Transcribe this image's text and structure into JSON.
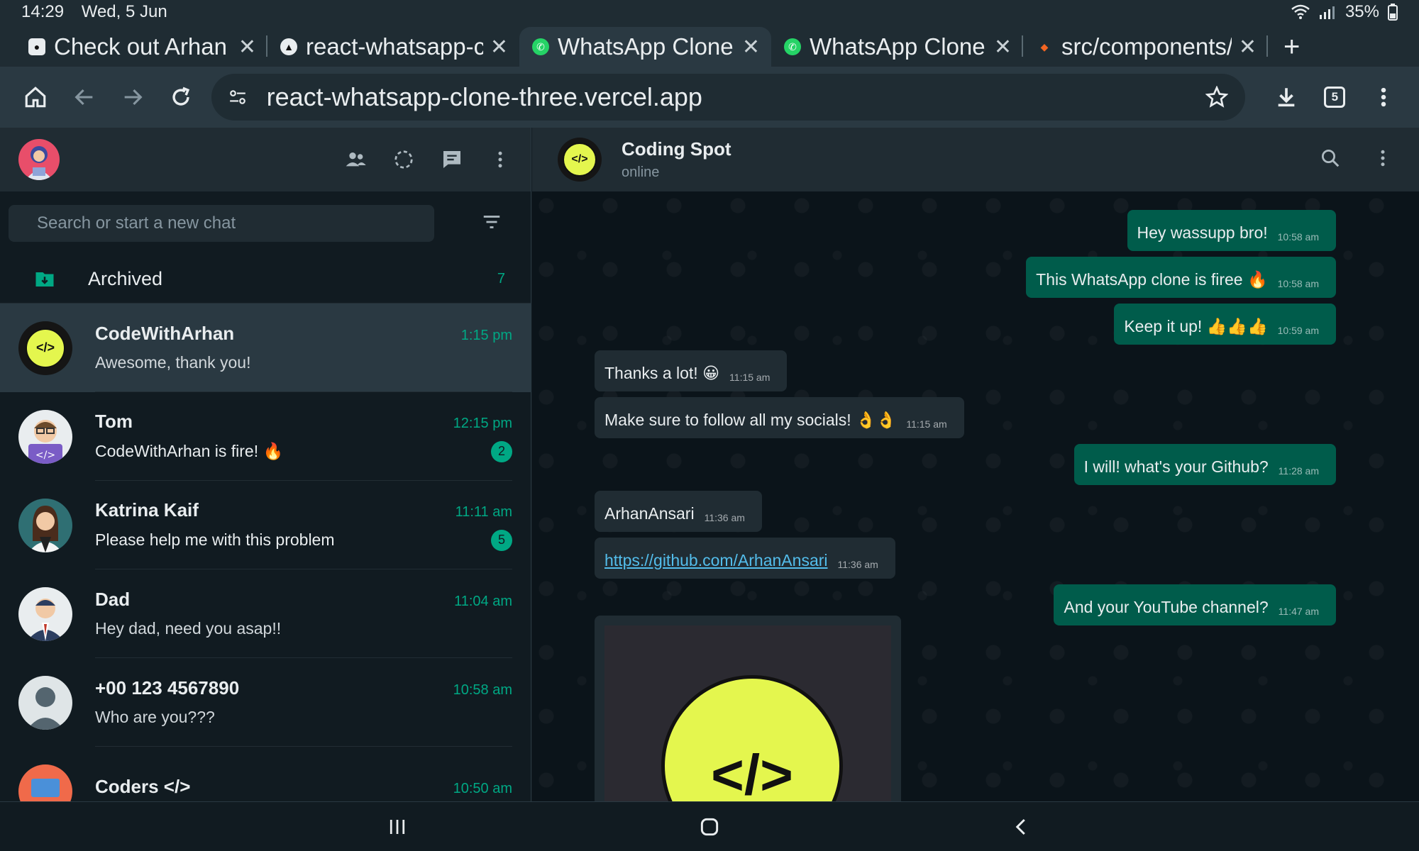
{
  "status_bar": {
    "time": "14:29",
    "date": "Wed, 5 Jun",
    "battery": "35%"
  },
  "tabs": [
    {
      "title": "Check out Arhan Ta",
      "icon": "github-icon",
      "active": false
    },
    {
      "title": "react-whatsapp-clo",
      "icon": "vercel-icon",
      "active": false
    },
    {
      "title": "WhatsApp Clone",
      "icon": "whatsapp-icon",
      "active": true
    },
    {
      "title": "WhatsApp Clone",
      "icon": "whatsapp-icon",
      "active": false
    },
    {
      "title": "src/components/P",
      "icon": "figma-icon",
      "active": false
    }
  ],
  "address_bar": {
    "url": "react-whatsapp-clone-three.vercel.app",
    "tab_count": "5"
  },
  "sidebar": {
    "search_placeholder": "Search or start a new chat",
    "archived": {
      "label": "Archived",
      "count": "7"
    },
    "chats": [
      {
        "name": "CodeWithArhan",
        "last_message": "Awesome, thank you!",
        "time": "1:15 pm",
        "unread": ""
      },
      {
        "name": "Tom",
        "last_message": "CodeWithArhan is fire! 🔥",
        "time": "12:15 pm",
        "unread": "2"
      },
      {
        "name": "Katrina Kaif",
        "last_message": "Please help me with this problem",
        "time": "11:11 am",
        "unread": "5"
      },
      {
        "name": "Dad",
        "last_message": "Hey dad, need you asap!!",
        "time": "11:04 am",
        "unread": ""
      },
      {
        "name": "+00 123 4567890",
        "last_message": "Who are you???",
        "time": "10:58 am",
        "unread": ""
      },
      {
        "name": "Coders </>",
        "last_message": "",
        "time": "10:50 am",
        "unread": ""
      }
    ]
  },
  "conversation": {
    "name": "Coding Spot",
    "status": "online",
    "messages": [
      {
        "dir": "out",
        "text": "Hey wassupp bro!",
        "time": "10:58 am"
      },
      {
        "dir": "out",
        "text": "This WhatsApp clone is firee 🔥",
        "time": "10:58 am"
      },
      {
        "dir": "out",
        "text": "Keep it up! 👍👍👍",
        "time": "10:59 am"
      },
      {
        "dir": "in",
        "text": "Thanks a lot! 😀",
        "time": "11:15 am"
      },
      {
        "dir": "in",
        "text": "Make sure to follow all my socials! 👌👌",
        "time": "11:15 am"
      },
      {
        "dir": "out",
        "text": "I will! what's your Github?",
        "time": "11:28 am"
      },
      {
        "dir": "in",
        "text": "ArhanAnsari",
        "time": "11:36 am"
      },
      {
        "dir": "in",
        "text": "https://github.com/ArhanAnsari",
        "time": "11:36 am",
        "link": true
      },
      {
        "dir": "out",
        "text": "And your YouTube channel?",
        "time": "11:47 am"
      }
    ],
    "media_glyph": "</>"
  },
  "colors": {
    "accent": "#00a884",
    "outgoing_bubble": "#005c4b",
    "incoming_bubble": "#202c33",
    "panel": "#202c33",
    "background": "#111b21"
  }
}
